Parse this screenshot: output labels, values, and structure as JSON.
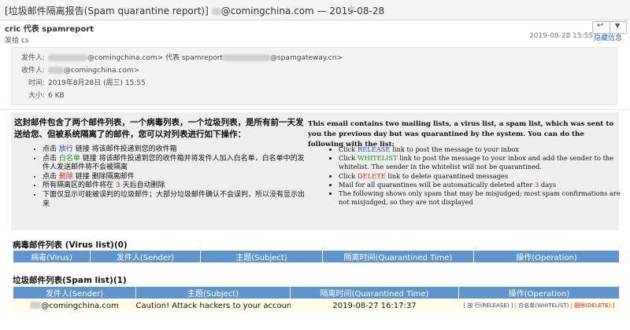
{
  "window": {
    "title": "[垃圾邮件隔离报告(Spam quarantine report)] ",
    "title_suffix": "@comingchina.com — 2019-08-28",
    "star_icon": "star-icon"
  },
  "header": {
    "from": "cric 代表 spamreport",
    "sent_by": "发给 cs",
    "date": "2019-08-28 15:55",
    "hide_details": "隐藏信息",
    "reply_icon": "reply-icon",
    "dropdown_icon": "chevron-down-icon"
  },
  "details": {
    "from_label": "发件人:",
    "from_value_a": "@comingchina.com> 代表 spamreport",
    "from_value_b": "@spamgateway.cn>",
    "to_label": "收件人:",
    "to_value": "@comingchina.com>",
    "time_label": "时间:",
    "time_value": "2019年8月28日 (周三) 15:55",
    "size_label": "大小:",
    "size_value": "6 KB"
  },
  "info": {
    "cn_heading": "这封邮件包含了两个邮件列表，一个病毒列表，一个垃圾列表，是所有前一天发送给您、但被系统隔离了的邮件，您可以对列表进行如下操作：",
    "cn_items": {
      "i1_pre": "点击 ",
      "i1_link": "放行",
      "i1_post": " 链接    将该邮件投递到您的收件箱",
      "i2_pre": "点击 ",
      "i2_link": "白名单",
      "i2_post": " 链接    将该邮件投递到您的收件箱并将发件人加入白名单，白名单中的发件人发送邮件将不会被隔离",
      "i3_pre": "点击 ",
      "i3_link": "删除",
      "i3_post": " 链接    删除隔离邮件",
      "i4_pre": "所有隔离区的邮件将在 ",
      "i4_num": "3",
      "i4_post": " 天后自动删除",
      "i5": "下面仅显示可能被误判的垃圾邮件；大部分垃圾邮件确认不会误判，所以没有显示出来"
    },
    "en_heading": "This email contains two mailing lists, a virus list, a spam list, which was sent to you the previous day but was quarantined by the system. You can do the following with the list:",
    "en_items": {
      "i1_pre": "Click ",
      "i1_link": "RELEASE",
      "i1_post": " link to post the message to your inbox",
      "i2_pre": "Click ",
      "i2_link": "WHITELIST",
      "i2_post": " link to post the message to your inbox and add the sender to the whitelist. The sender in the whitelist will not be quarantined.",
      "i3_pre": "Click ",
      "i3_link": "DELETE",
      "i3_post": " link to delete quarantined messages",
      "i4_pre": "Mail for all quarantines will be automatically deleted after ",
      "i4_num": "3",
      "i4_post": " days",
      "i5": "The following shows only spam that may be misjudged; most spam confirmations are not misjudged, so they are not displayed"
    }
  },
  "virus_list": {
    "title": "病毒邮件列表 (Virus list)(0)",
    "columns": [
      "病毒(Virus)",
      "发件人(Sender)",
      "主题(Subject)",
      "隔离时间(Quarantined Time)",
      "操作(Operation)"
    ]
  },
  "spam_list": {
    "title": "垃圾邮件列表(Spam list)(1)",
    "columns": [
      "发件人(Sender)",
      "主题(Subject)",
      "隔离时间(Quarantined Time)",
      "操作(Operation)"
    ],
    "rows": [
      {
        "sender": "@comingchina.com",
        "subject": "Caution! Attack hackers to your account!",
        "time": "2019-08-27 16:17:37",
        "release": "[ 放 行(RELEASE) ]",
        "whitelist": "白名单(WHITELIST)",
        "delete": "删除(DELETE) ]"
      }
    ]
  },
  "colors": {
    "table_header": "#5f95cf",
    "row_background": "#fffde8",
    "release_link": "#2a3fb8",
    "whitelist_link": "#1f8a2e",
    "delete_link": "#d42828"
  }
}
